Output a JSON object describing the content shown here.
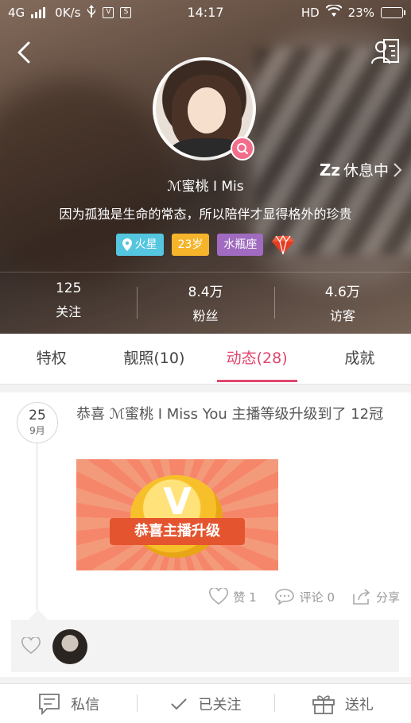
{
  "status_bar": {
    "network": "4G",
    "speed": "0K/s",
    "time": "14:17",
    "hd": "HD",
    "battery": "23%"
  },
  "profile": {
    "nickname": "ℳ蜜桃 I Mis",
    "rest_status": "休息中",
    "rest_zz": "Zz",
    "signature": "因为孤独是生命的常态，所以陪伴才显得格外的珍贵",
    "tags": {
      "location": "火星",
      "age": "23岁",
      "zodiac": "水瓶座"
    }
  },
  "stats": [
    {
      "value": "125",
      "label": "关注"
    },
    {
      "value": "8.4万",
      "label": "粉丝"
    },
    {
      "value": "4.6万",
      "label": "访客"
    }
  ],
  "tabs": [
    {
      "label": "特权"
    },
    {
      "label": "靓照(10)"
    },
    {
      "label": "动态(28)"
    },
    {
      "label": "成就"
    }
  ],
  "active_tab": 2,
  "post": {
    "day": "25",
    "month": "9月",
    "text": "恭喜 ℳ蜜桃 I Miss You 主播等级升级到了 12冠",
    "image_letter": "V",
    "image_banner": "恭喜主播升级",
    "like_label": "赞 1",
    "comment_label": "评论 0",
    "share_label": "分享"
  },
  "bottom_bar": {
    "message": "私信",
    "followed": "已关注",
    "gift": "送礼"
  },
  "colors": {
    "accent": "#e0466e",
    "location_tag": "#54c6e0",
    "age_tag": "#f6b42b",
    "zodiac_tag": "#a06bc0",
    "badge": "#f26d8c"
  }
}
